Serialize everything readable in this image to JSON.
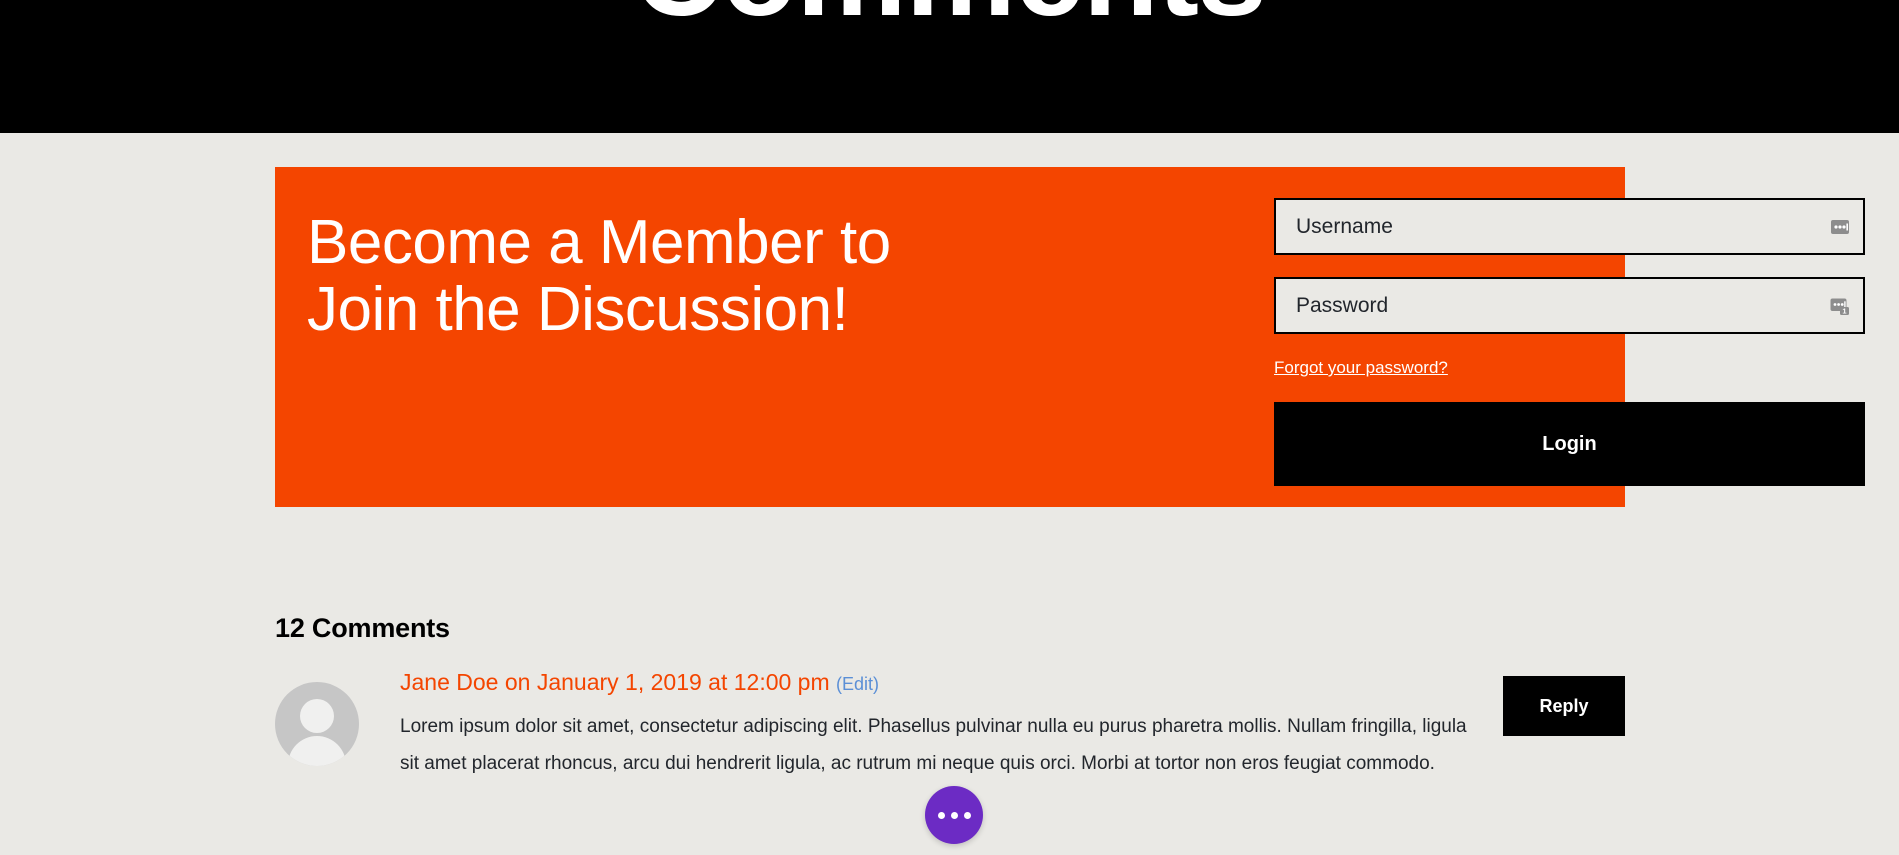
{
  "hero": {
    "title": "Comments"
  },
  "member_panel": {
    "heading": "Become a Member to Join the Discussion!",
    "accent_color": "#f44500",
    "username": {
      "value": "",
      "placeholder": "Username",
      "icon": "password-manager-fill-icon"
    },
    "password": {
      "value": "",
      "placeholder": "Password",
      "icon": "password-manager-fill-badge-icon"
    },
    "forgot_label": "Forgot your password?",
    "login_label": "Login"
  },
  "comments": {
    "count_label": "12 Comments",
    "items": [
      {
        "author": "Jane Doe",
        "meta": "Jane Doe on January 1, 2019 at 12:00 pm",
        "edit_label": "(Edit)",
        "body": "Lorem ipsum dolor sit amet, consectetur adipiscing elit. Phasellus pulvinar nulla eu purus pharetra mollis. Nullam fringilla, ligula sit amet placerat rhoncus, arcu dui hendrerit ligula, ac rutrum mi neque quis orci. Morbi at tortor non eros feugiat commodo.",
        "reply_label": "Reply",
        "avatar": "default-user-avatar",
        "meta_color": "#f44500",
        "edit_color": "#5b8fd6"
      }
    ]
  },
  "floating_action": {
    "icon": "ellipsis-icon",
    "color": "#6c2bc4"
  }
}
